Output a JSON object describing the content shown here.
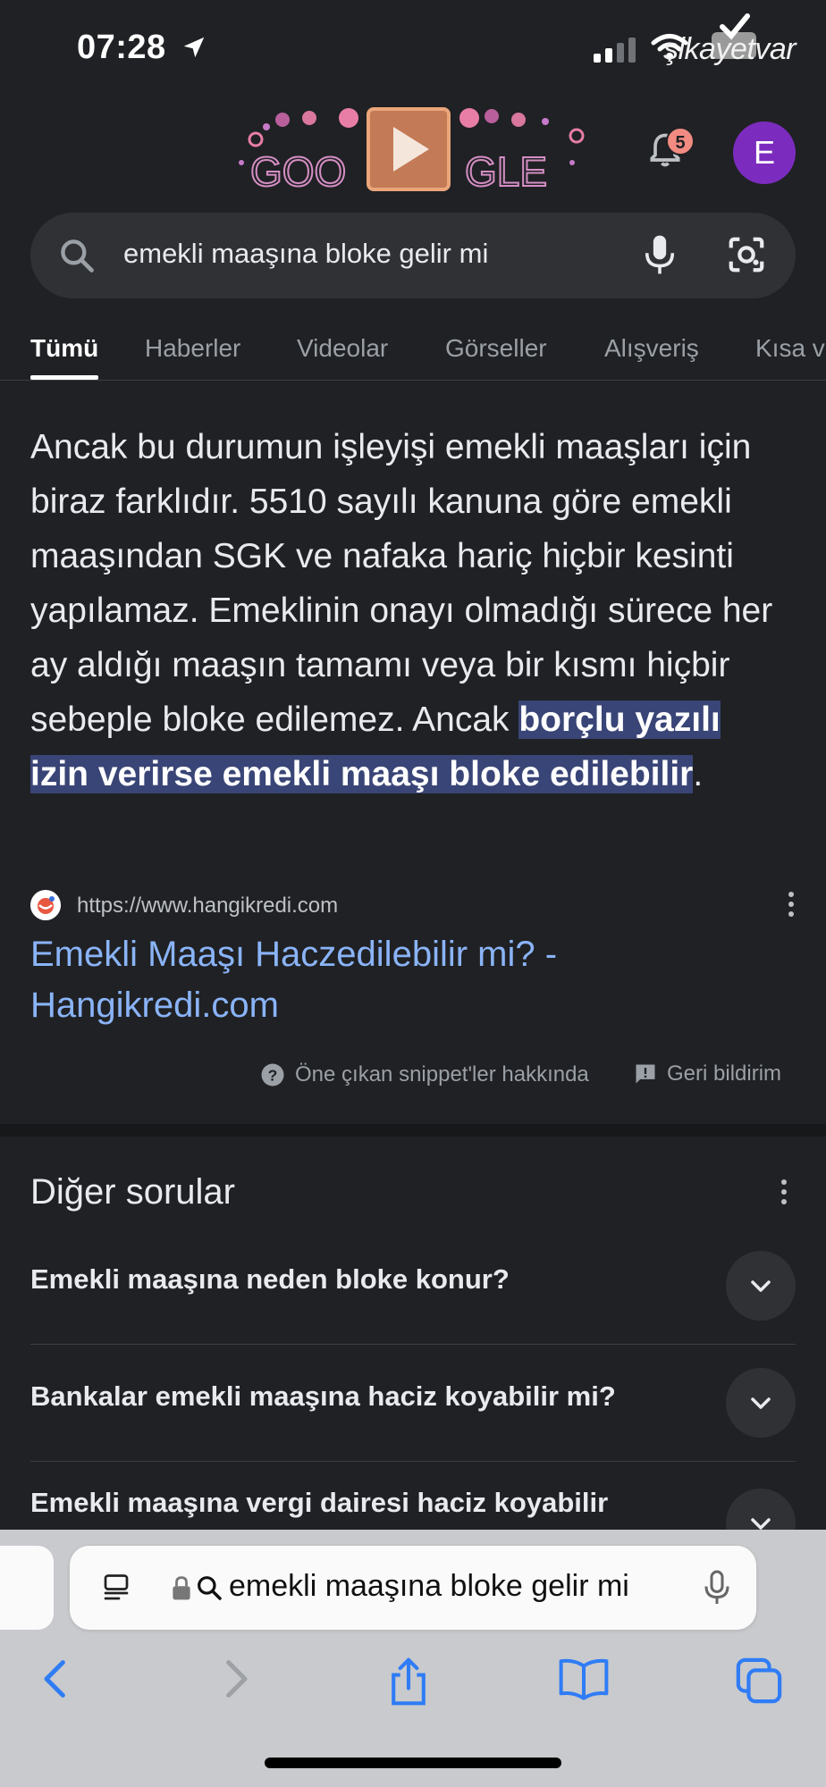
{
  "status_bar": {
    "time": "07:28",
    "watermark": "şikayetvar"
  },
  "header": {
    "logo_text": "GOOGLE",
    "notifications_count": "5",
    "avatar_initial": "E"
  },
  "search": {
    "query": "emekli maaşına bloke gelir mi"
  },
  "tabs": [
    "Tümü",
    "Haberler",
    "Videolar",
    "Görseller",
    "Alışveriş",
    "Kısa v"
  ],
  "snippet": {
    "text_before": "Ancak bu durumun işleyişi emekli maaşları için biraz farklıdır. 5510 sayılı kanuna göre emekli maaşından SGK ve nafaka hariç hiçbir kesinti yapılamaz. Emeklinin onayı olmadığı sürece her ay aldığı maaşın tamamı veya bir kısmı hiçbir sebeple bloke edilemez. Ancak ",
    "highlight": "borçlu yazılı izin verirse emekli maaşı bloke edilebilir",
    "text_after": ".",
    "source_url": "https://www.hangikredi.com",
    "result_title": "Emekli Maaşı Haczedilebilir mi? - Hangikredi.com",
    "about_label": "Öne çıkan snippet'ler hakkında",
    "feedback_label": "Geri bildirim"
  },
  "paa": {
    "title": "Diğer sorular",
    "questions": [
      "Emekli maaşına neden bloke konur?",
      "Bankalar emekli maaşına haciz koyabilir mi?",
      "Emekli maaşına vergi dairesi haciz koyabilir"
    ]
  },
  "browser": {
    "address_text": "emekli maaşına bloke gelir mi"
  },
  "colors": {
    "background": "#202124",
    "link": "#8ab4f8",
    "highlight": "#394576",
    "avatar": "#7b2cbf",
    "badge": "#f28b82"
  }
}
